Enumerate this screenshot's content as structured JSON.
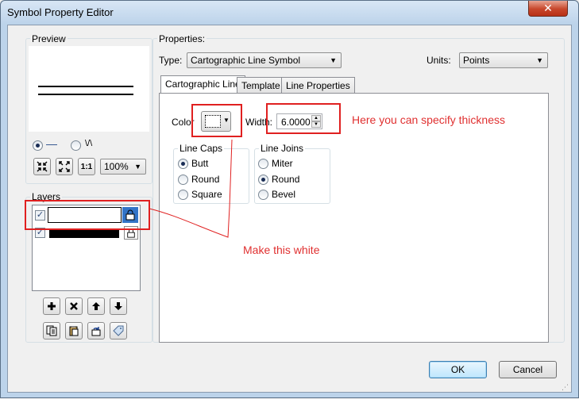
{
  "window": {
    "title": "Symbol Property Editor",
    "close_glyph": "✕"
  },
  "preview": {
    "label": "Preview",
    "zoom": "100%",
    "mode_line_glyph": "—",
    "mode_wave_glyph": "\\/\\"
  },
  "layers": {
    "label": "Layers",
    "items": [
      {
        "checked": true
      },
      {
        "checked": true
      }
    ],
    "buttons": [
      "add-icon",
      "delete-icon",
      "move-up-icon",
      "move-down-icon",
      "copy-icon",
      "paste-icon",
      "reset-icon",
      "tag-icon"
    ]
  },
  "properties": {
    "label": "Properties:",
    "type_label": "Type:",
    "type_value": "Cartographic Line Symbol",
    "units_label": "Units:",
    "units_value": "Points",
    "tabs": [
      "Cartographic Line",
      "Template",
      "Line Properties"
    ],
    "color_label": "Color",
    "width_label": "Width:",
    "width_value": "6.0000",
    "line_caps": {
      "label": "Line Caps",
      "options": [
        "Butt",
        "Round",
        "Square"
      ],
      "selected": "Butt"
    },
    "line_joins": {
      "label": "Line Joins",
      "options": [
        "Miter",
        "Round",
        "Bevel"
      ],
      "selected": "Round"
    }
  },
  "footer": {
    "ok": "OK",
    "cancel": "Cancel"
  },
  "annotations": {
    "thickness": "Here you can specify thickness",
    "white": "Make this white"
  },
  "colors": {
    "annotation": "#e03030",
    "title_bg": "#bcd3ea"
  }
}
